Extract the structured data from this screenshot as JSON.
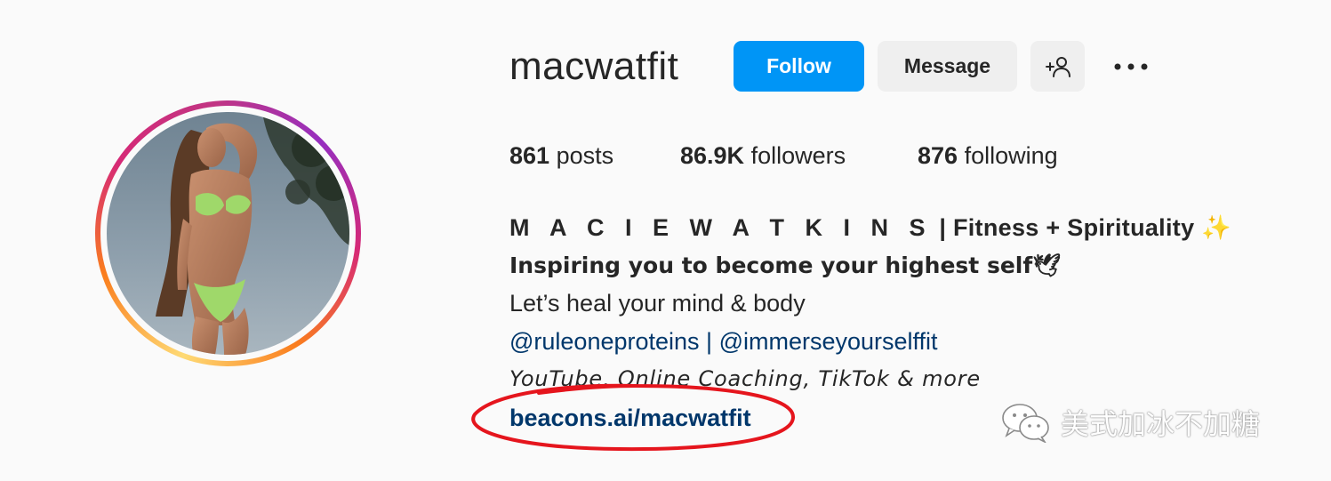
{
  "profile": {
    "username": "macwatfit",
    "follow_label": "Follow",
    "message_label": "Message",
    "add_user_icon": "add-user-icon",
    "more_icon": "more-options-icon"
  },
  "stats": {
    "posts_count": "861",
    "posts_label": "posts",
    "followers_count": "86.9K",
    "followers_label": "followers",
    "following_count": "876",
    "following_label": "following"
  },
  "bio": {
    "name_spaced": "M A C I E W A T K I N S",
    "name_rest": "| Fitness + Spirituality ✨",
    "line_bold": "Inspiring you to become your highest self🕊",
    "line_plain": "Let’s heal your mind & body",
    "mention_1": "@ruleoneproteins",
    "mention_sep": " | ",
    "mention_2": "@immerseyourselffit",
    "line_italic": "YouTube, Online Coaching, TikTok & more",
    "link": "beacons.ai/macwatfit"
  },
  "watermark": {
    "text": "美式加冰不加糖",
    "icon": "wechat-icon"
  },
  "colors": {
    "follow_blue": "#0095f6",
    "link_navy": "#00376b",
    "annotation_red": "#e5151d"
  }
}
